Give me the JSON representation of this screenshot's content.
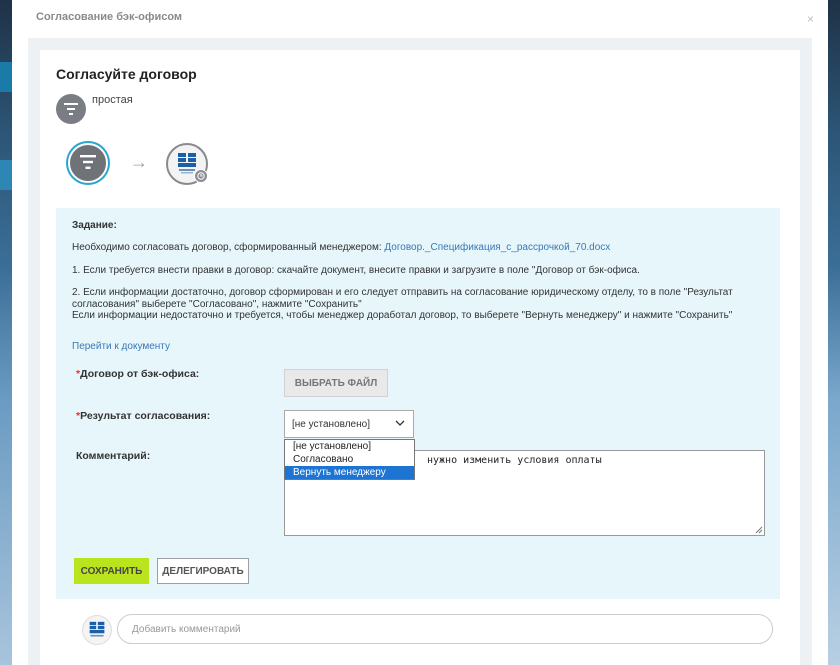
{
  "modal": {
    "title": "Согласование бэк-офисом",
    "close_label": "×"
  },
  "card": {
    "title": "Согласуйте договор",
    "process_type": "простая",
    "process_icon": "filter-icon",
    "step2_icon": "company-logo",
    "arrow": "→"
  },
  "task": {
    "heading": "Задание:",
    "intro_text": "Необходимо согласовать договор, сформированный менеджером: ",
    "file_link": "Договор._Спецификация_с_рассрочкой_70.docx",
    "item1": "1. Если требуется внести правки в договор: скачайте документ, внесите правки и загрузите в поле \"Договор от бэк-офиса.",
    "item2_line1": "2. Если информации достаточно, договор сформирован и его следует отправить на согласование юридическому отделу, то в поле \"Результат",
    "item2_line2": "согласования\" выберете \"Согласовано\", нажмите \"Сохранить\"",
    "item2_line3": "Если информации недостаточно и требуется, чтобы менеджер доработал договор, то выберете \"Вернуть менеджеру\" и нажмите \"Сохранить\"",
    "goto_doc_link": "Перейти к документу"
  },
  "form": {
    "required_mark": "*",
    "contract_label": "Договор от бэк-офиса:",
    "choose_file_label": "ВЫБРАТЬ ФАЙЛ",
    "result_label": "Результат согласования:",
    "result_selected": "[не установлено]",
    "result_options": [
      "[не установлено]",
      "Согласовано",
      "Вернуть менеджеру"
    ],
    "result_highlighted_index": 2,
    "comment_label": "Комментарий:",
    "comment_value": "нужно изменить условия оплаты",
    "save_label": "СОХРАНИТЬ",
    "delegate_label": "ДЕЛЕГИРОВАТЬ"
  },
  "comments": {
    "placeholder": "Добавить комментарий"
  },
  "colors": {
    "accent_ring": "#29a6cf",
    "save_button": "#b9e41e",
    "task_panel": "#e6f6fb",
    "link": "#3a78b7",
    "selected_option": "#1e74d3"
  }
}
